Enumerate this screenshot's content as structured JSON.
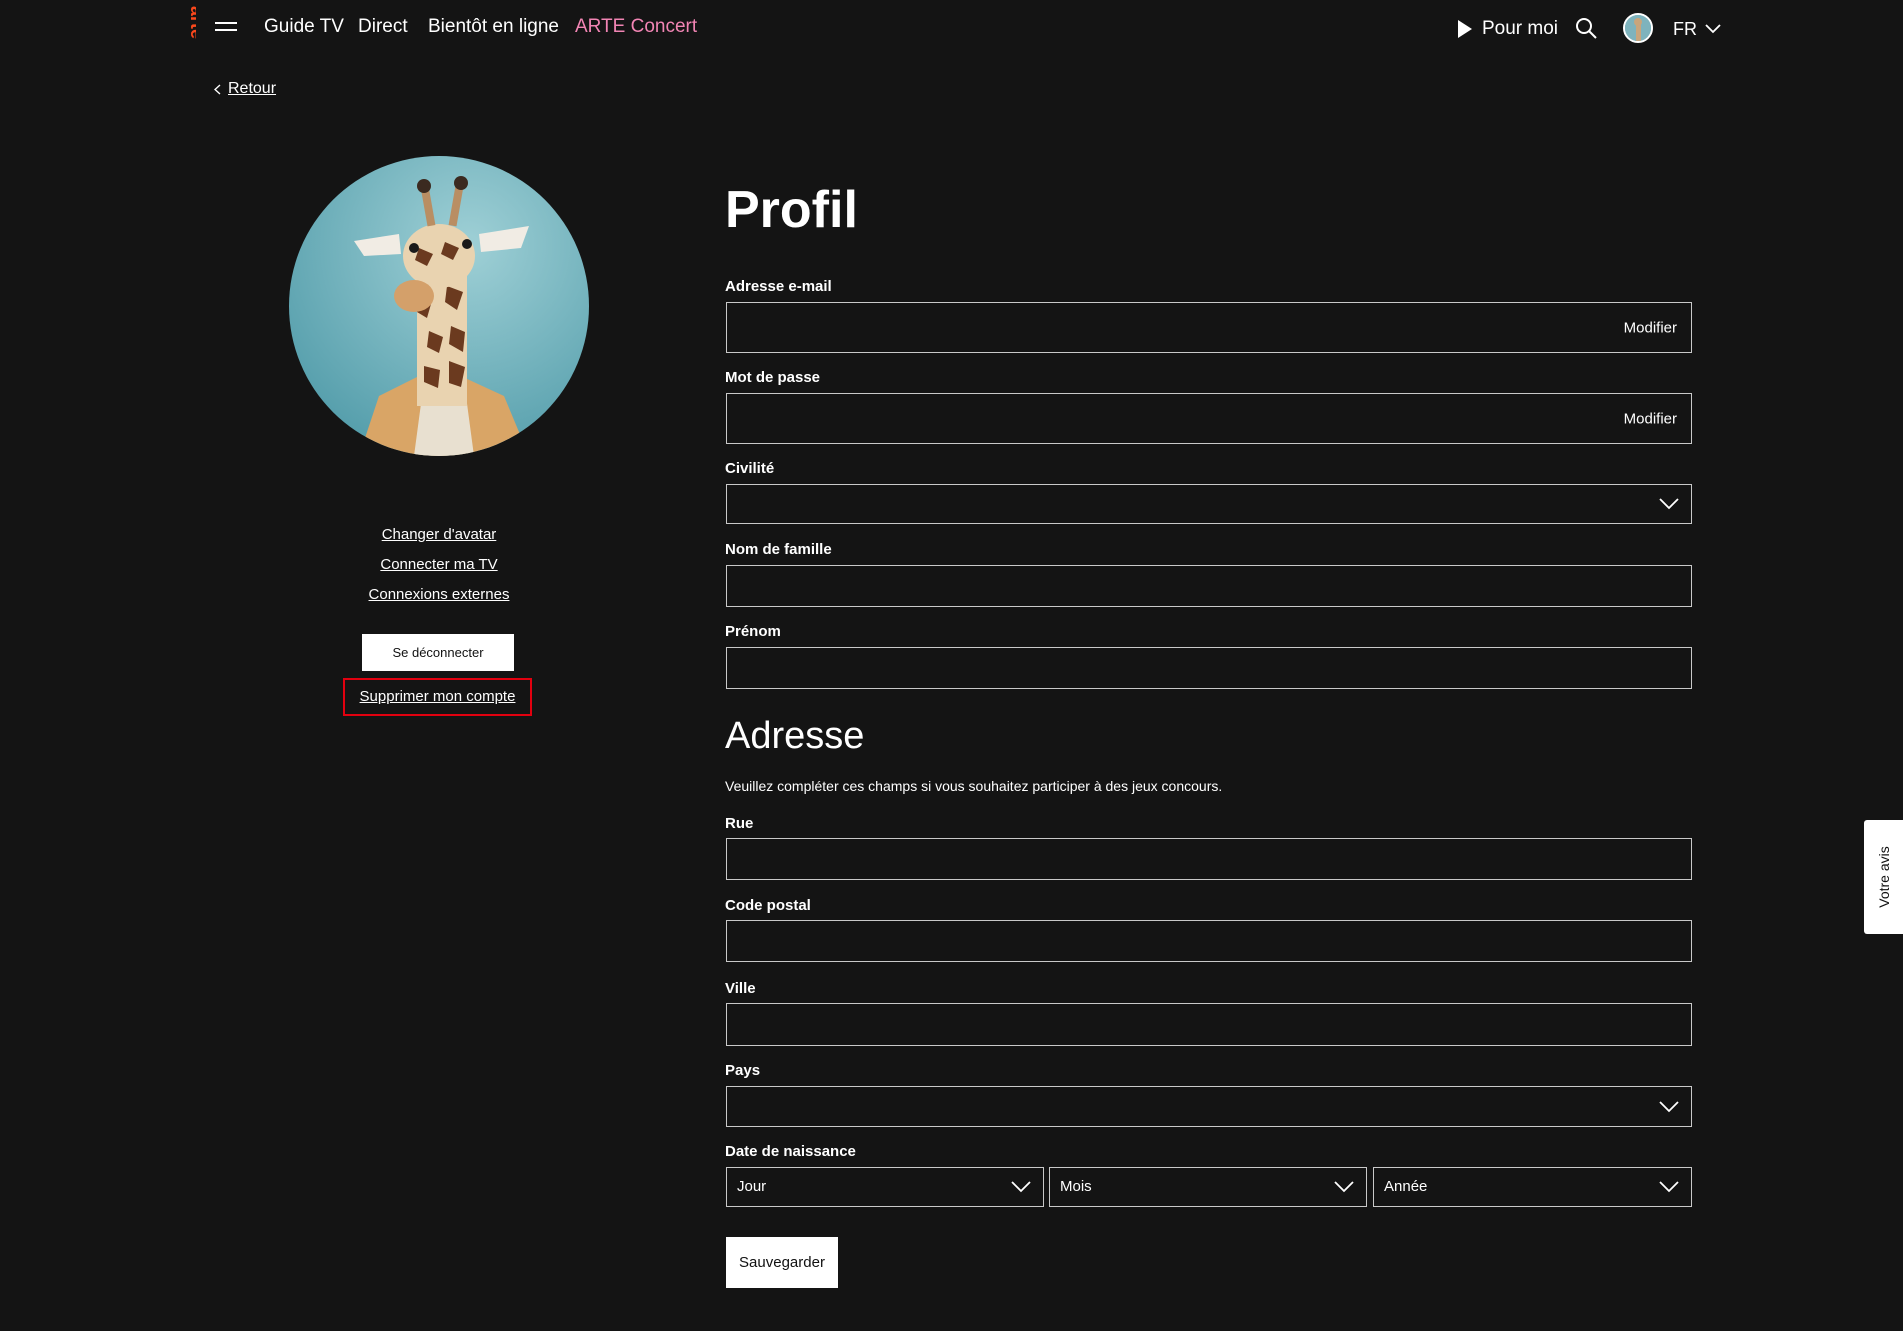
{
  "header": {
    "logo_text": "arte",
    "nav": [
      "Guide TV",
      "Direct",
      "Bientôt en ligne",
      "ARTE Concert"
    ],
    "pour_moi": "Pour moi",
    "language": "FR"
  },
  "back_label": "Retour",
  "sidebar": {
    "change_avatar": "Changer d'avatar",
    "connect_tv": "Connecter ma TV",
    "external_connections": "Connexions externes",
    "logout": "Se déconnecter",
    "delete_account": "Supprimer mon compte"
  },
  "profile": {
    "title": "Profil",
    "email_label": "Adresse e-mail",
    "email_action": "Modifier",
    "password_label": "Mot de passe",
    "password_action": "Modifier",
    "civility_label": "Civilité",
    "lastname_label": "Nom de famille",
    "firstname_label": "Prénom"
  },
  "address": {
    "title": "Adresse",
    "hint": "Veuillez compléter ces champs si vous souhaitez participer à des jeux concours.",
    "street_label": "Rue",
    "postal_label": "Code postal",
    "city_label": "Ville",
    "country_label": "Pays",
    "birth_label": "Date de naissance",
    "day": "Jour",
    "month": "Mois",
    "year": "Année"
  },
  "save_label": "Sauvegarder",
  "feedback_label": "Votre avis",
  "colors": {
    "accent": "#fa481c",
    "concert": "#f285b4",
    "background": "#141414",
    "highlight": "#e2000f"
  }
}
